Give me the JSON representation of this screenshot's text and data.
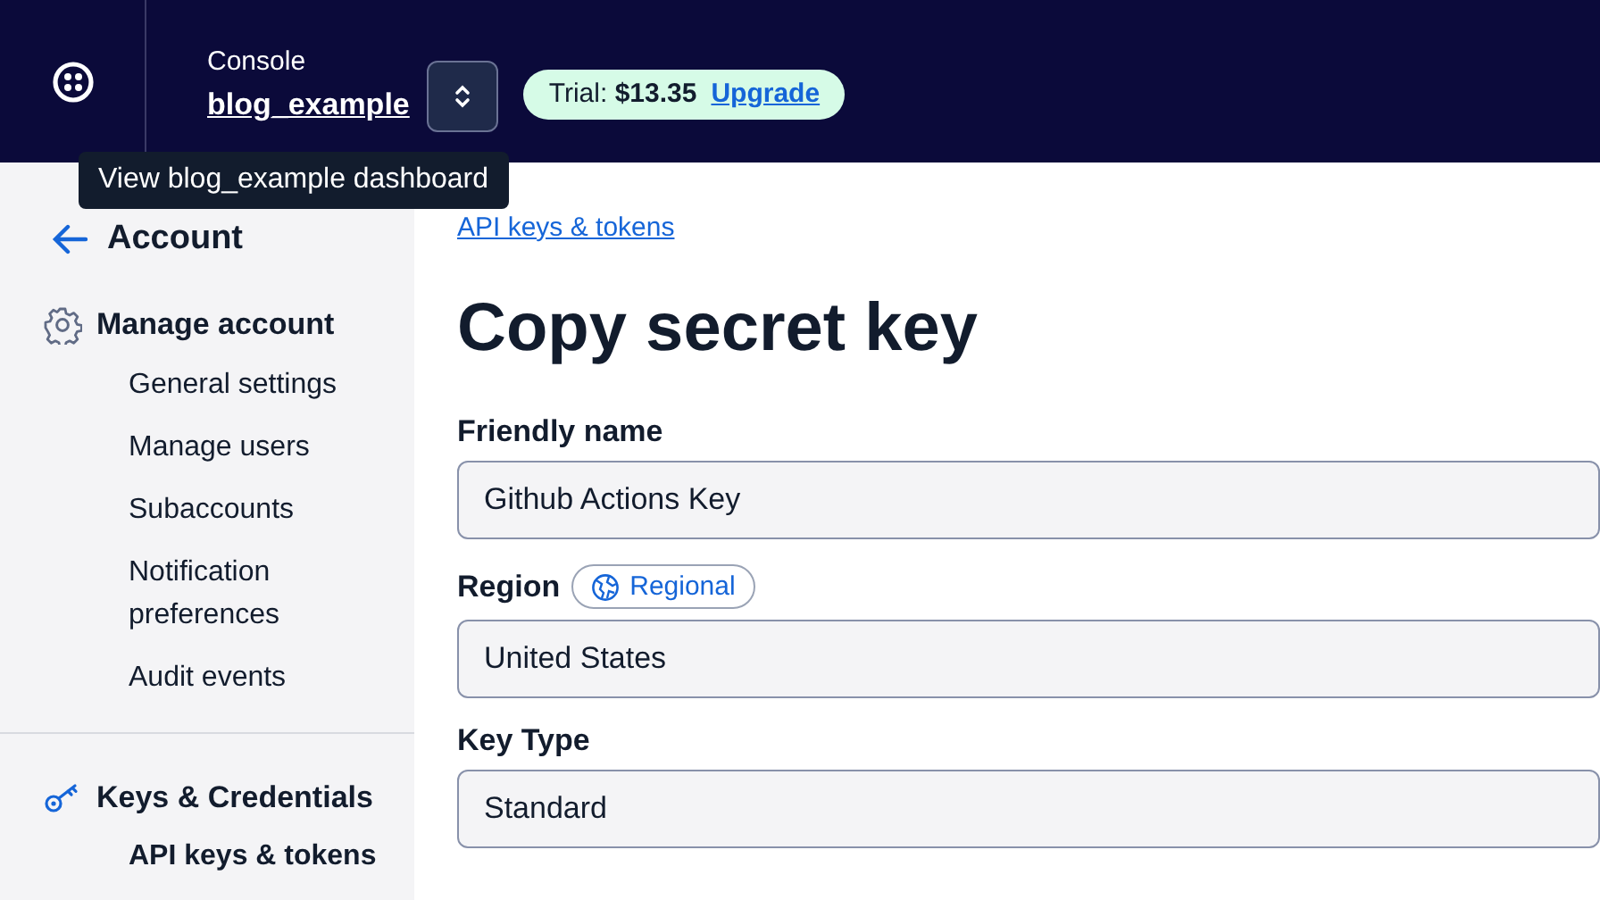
{
  "header": {
    "console_label": "Console",
    "account_link": "blog_example",
    "trial": {
      "label": "Trial:",
      "amount": "$13.35",
      "upgrade": "Upgrade"
    }
  },
  "tooltip": "View blog_example dashboard",
  "sidebar": {
    "back_title": "Account",
    "sections": [
      {
        "title": "Manage account",
        "kind": "gear",
        "items": [
          {
            "label": "General settings",
            "selected": false
          },
          {
            "label": "Manage users",
            "selected": false
          },
          {
            "label": "Subaccounts",
            "selected": false
          },
          {
            "label": "Notification preferences",
            "selected": false
          },
          {
            "label": "Audit events",
            "selected": false
          }
        ]
      },
      {
        "title": "Keys & Credentials",
        "kind": "key",
        "items": [
          {
            "label": "API keys & tokens",
            "selected": true
          }
        ]
      }
    ]
  },
  "breadcrumb": "API keys & tokens",
  "title": "Copy secret key",
  "fields": [
    {
      "label": "Friendly name",
      "value": "Github Actions Key"
    },
    {
      "label": "Region",
      "badge": "Regional",
      "value": "United States"
    },
    {
      "label": "Key Type",
      "value": "Standard"
    }
  ]
}
